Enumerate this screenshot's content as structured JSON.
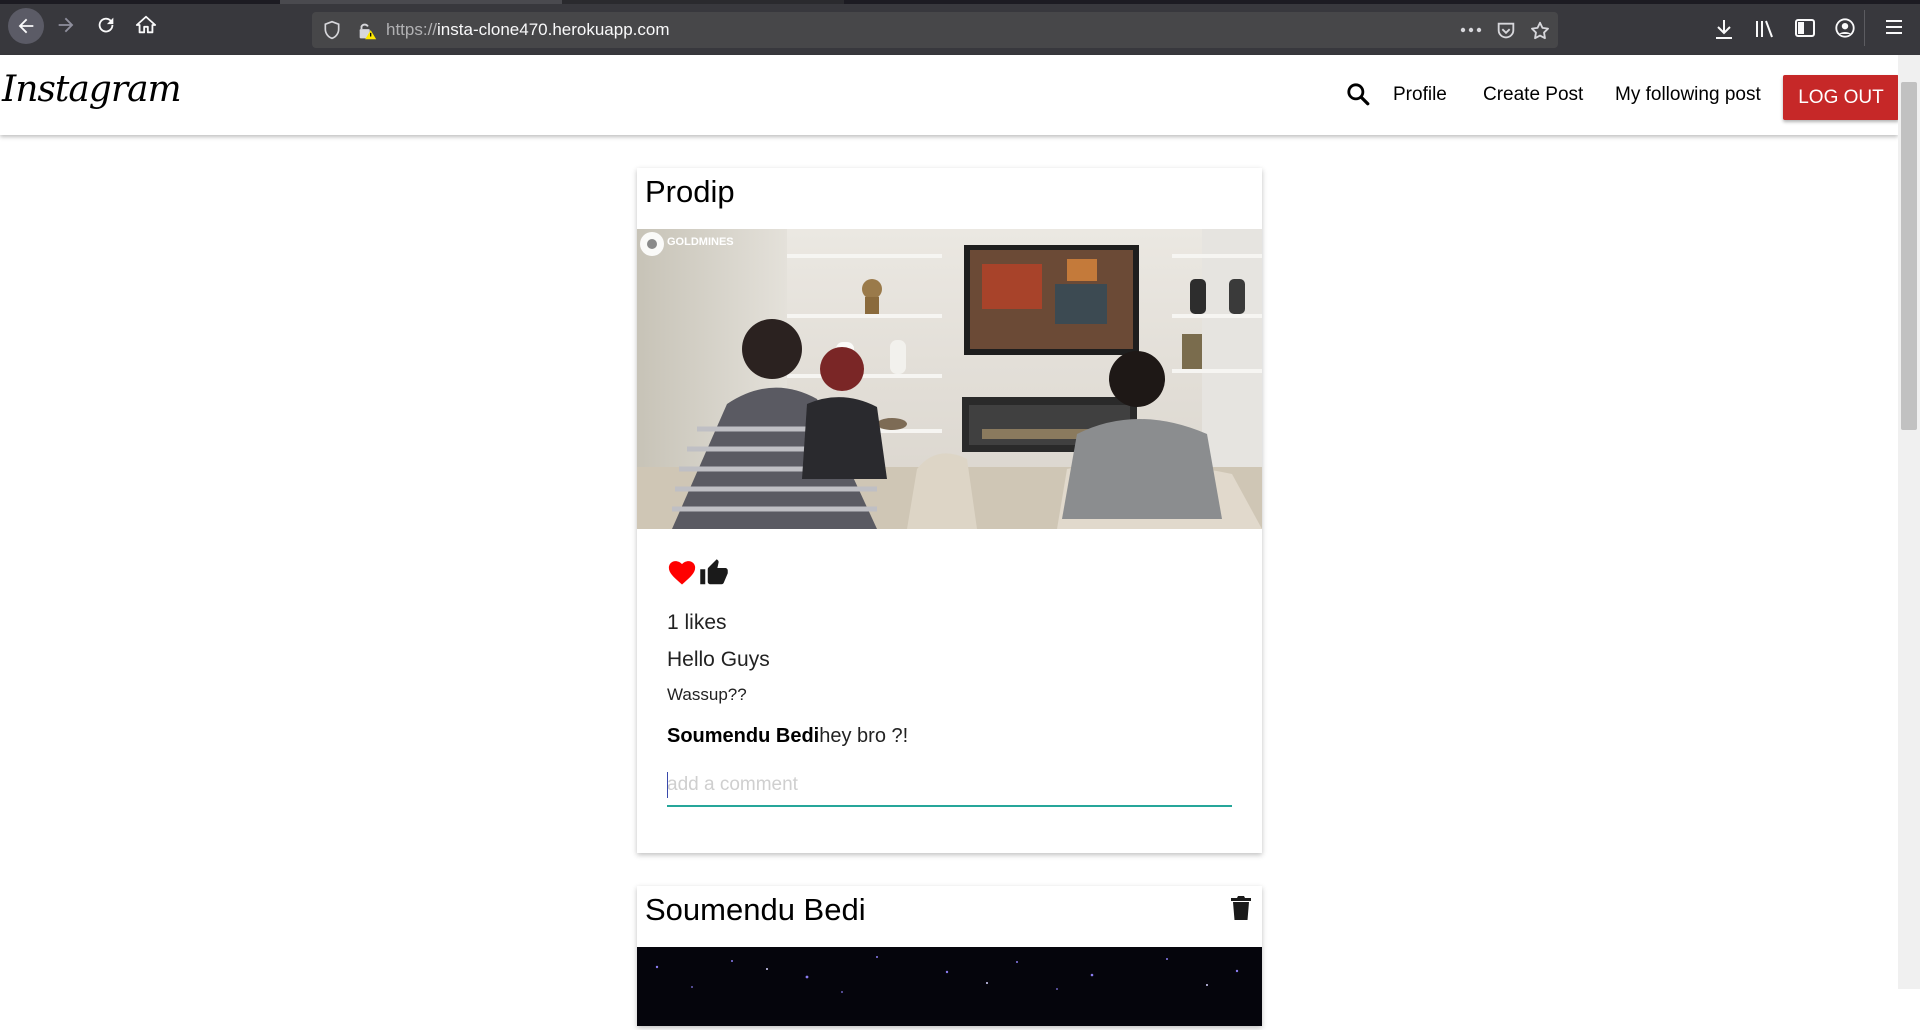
{
  "browser": {
    "url_scheme": "https://",
    "url_host": "insta-clone470.herokuapp.com"
  },
  "navbar": {
    "brand": "Instagram",
    "links": [
      "Profile",
      "Create Post",
      "My following post"
    ],
    "logout_label": "LOG OUT"
  },
  "posts": [
    {
      "author": "Prodip",
      "image_watermark": "GOLDMINES",
      "likes_text": "1 likes",
      "title": "Hello Guys",
      "body": "Wassup??",
      "comments": [
        {
          "user": "Soumendu Bedi",
          "text": "hey bro ?!"
        }
      ],
      "comment_placeholder": "add a comment",
      "liked": true
    },
    {
      "author": "Soumendu Bedi",
      "deletable": true
    }
  ],
  "colors": {
    "chrome_bg": "#38383d",
    "logout_bg": "#c62828",
    "input_focus": "#26a69a",
    "heart": "#ff0000"
  },
  "icons": {
    "back": "arrow-left-icon",
    "forward": "arrow-right-icon",
    "reload": "reload-icon",
    "home": "home-icon",
    "search": "search-icon",
    "like": "heart-icon",
    "thumb": "thumbs-up-icon",
    "delete": "trash-icon"
  }
}
